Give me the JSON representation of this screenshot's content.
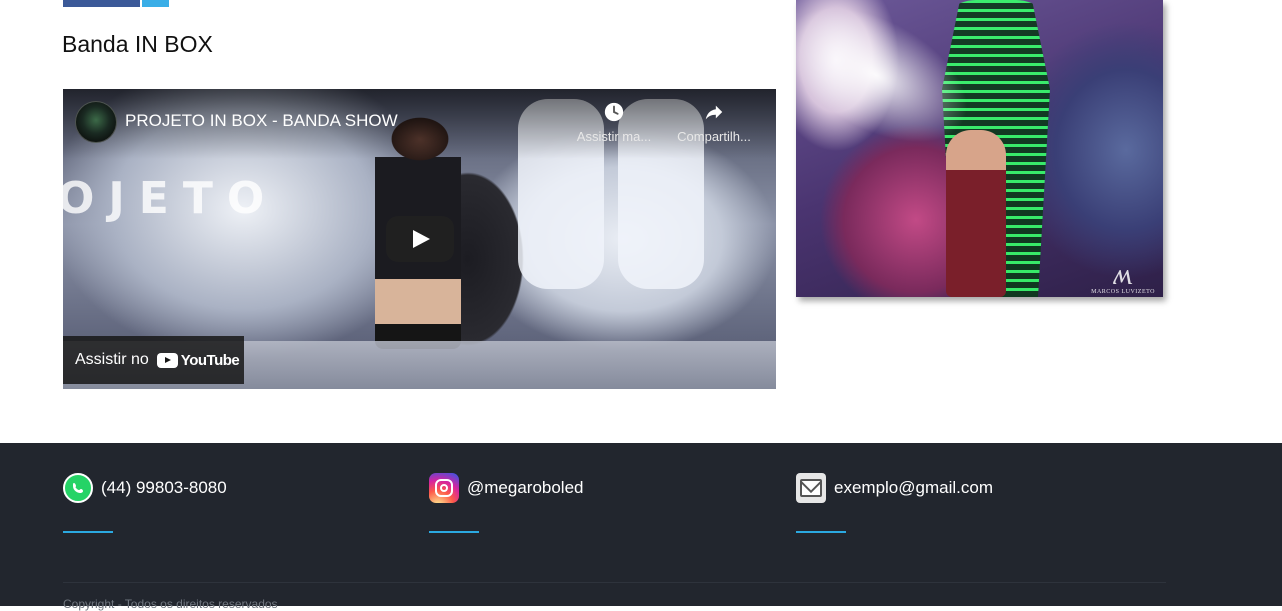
{
  "page": {
    "title": "Banda IN BOX"
  },
  "share": {
    "facebook_color": "#3b5998",
    "twitter_color": "#3aaee7"
  },
  "video": {
    "title": "PROJETO IN BOX - BANDA SHOW",
    "watch_later_label": "Assistir ma...",
    "share_label": "Compartilh...",
    "watch_on_label": "Assistir no",
    "youtube_logo_text": "YouTube",
    "overlay_word": "OJETO"
  },
  "photo": {
    "signature_text": "MARCOS LUVIZETO"
  },
  "footer": {
    "accent_color": "#2ba9e1",
    "contacts": [
      {
        "icon": "whatsapp-icon",
        "text": "(44) 99803-8080"
      },
      {
        "icon": "instagram-icon",
        "text": "@megaroboled"
      },
      {
        "icon": "email-icon",
        "text": "exemplo@gmail.com"
      }
    ],
    "copyright": "Copyright - Todos os direitos reservados"
  }
}
